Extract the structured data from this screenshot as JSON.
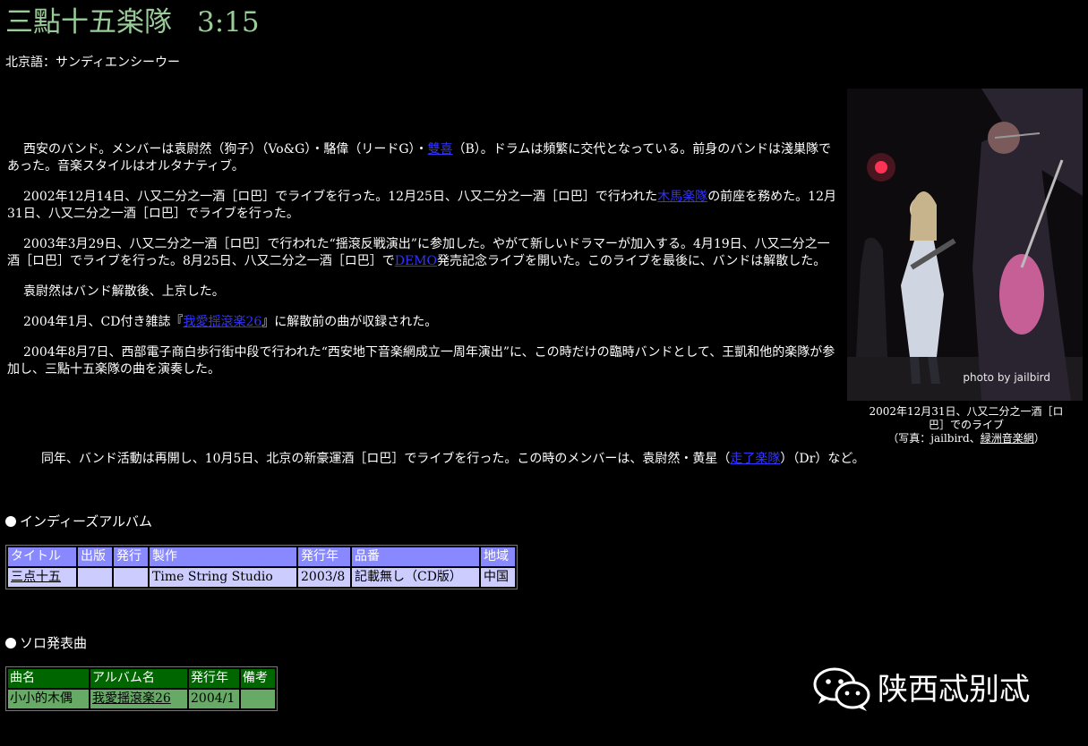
{
  "page": {
    "title": "三點十五楽隊",
    "title_time": "3:15",
    "pinyin": "北京語：サンディエンシーウー"
  },
  "body": {
    "p1": {
      "a": "西安のバンド。メンバーは袁尉然（狗子）（Vo&G）・駱偉（リードG）・",
      "link": "雙喜",
      "b": "（B）。ドラムは頻繁に交代となっている。前身のバンドは淺巣隊であった。音楽スタイルはオルタナティブ。"
    },
    "p2": {
      "a": "2002年12月14日、八又二分之一酒［ロ巴］でライブを行った。12月25日、八又二分之一酒［ロ巴］で行われた",
      "link": "木馬楽隊",
      "b": "の前座を務めた。12月31日、八又二分之一酒［ロ巴］でライブを行った。"
    },
    "p3": {
      "a": "2003年3月29日、八又二分之一酒［ロ巴］で行われた“揺滾反戦演出”に参加した。やがて新しいドラマーが加入する。4月19日、八又二分之一酒［ロ巴］でライブを行った。8月25日、八又二分之一酒［ロ巴］で",
      "link": "DEMO",
      "b": "発売記念ライブを開いた。このライブを最後に、バンドは解散した。"
    },
    "p4": "袁尉然はバンド解散後、上京した。",
    "p5": {
      "a": "2004年1月、CD付き雑誌『",
      "link": "我愛揺滾楽26",
      "b": "』に解散前の曲が収録された。"
    },
    "p6": "2004年8月7日、西部電子商白歩行街中段で行われた“西安地下音楽網成立一周年演出”に、この時だけの臨時バンドとして、王凱和他的楽隊が参加し、三點十五楽隊の曲を演奏した。",
    "p7": {
      "a": "同年、バンド活動は再開し、10月5日、北京の新豪運酒［ロ巴］でライブを行った。この時のメンバーは、袁尉然・黄星（",
      "link": "走了楽隊",
      "b": "）（Dr）など。"
    }
  },
  "photo": {
    "credit": "photo by jailbird",
    "caption_line1": "2002年12月31日、八又二分之一酒［ロ",
    "caption_line2": "巴］でのライブ",
    "caption_line3a": "（写真：jailbird、",
    "caption_link": "緑洲音楽網",
    "caption_line3b": "）"
  },
  "indies": {
    "heading": "インディーズアルバム",
    "headers": [
      "タイトル",
      "出版",
      "発行",
      "製作",
      "発行年",
      "品番",
      "地域"
    ],
    "row": {
      "title": "三点十五",
      "publisher": "",
      "distributor": "",
      "producer": "Time String Studio",
      "year": "2003/8",
      "catalog": "記載無し（CD版）",
      "region": "中国"
    }
  },
  "solo": {
    "heading": "ソロ発表曲",
    "headers": [
      "曲名",
      "アルバム名",
      "発行年",
      "備考"
    ],
    "row": {
      "song": "小小的木偶",
      "album": "我愛揺滾楽26",
      "year": "2004/1",
      "note": ""
    }
  },
  "watermark": {
    "text": "陕西忒别忒",
    "icon": "wechat-icon"
  },
  "colors": {
    "background": "#000000",
    "title": "#99cc99",
    "link": "#3333ff",
    "indies_header": "#8888ff",
    "indies_cell": "#ccccff",
    "solo_header": "#006600",
    "solo_cell": "#66aa66"
  }
}
